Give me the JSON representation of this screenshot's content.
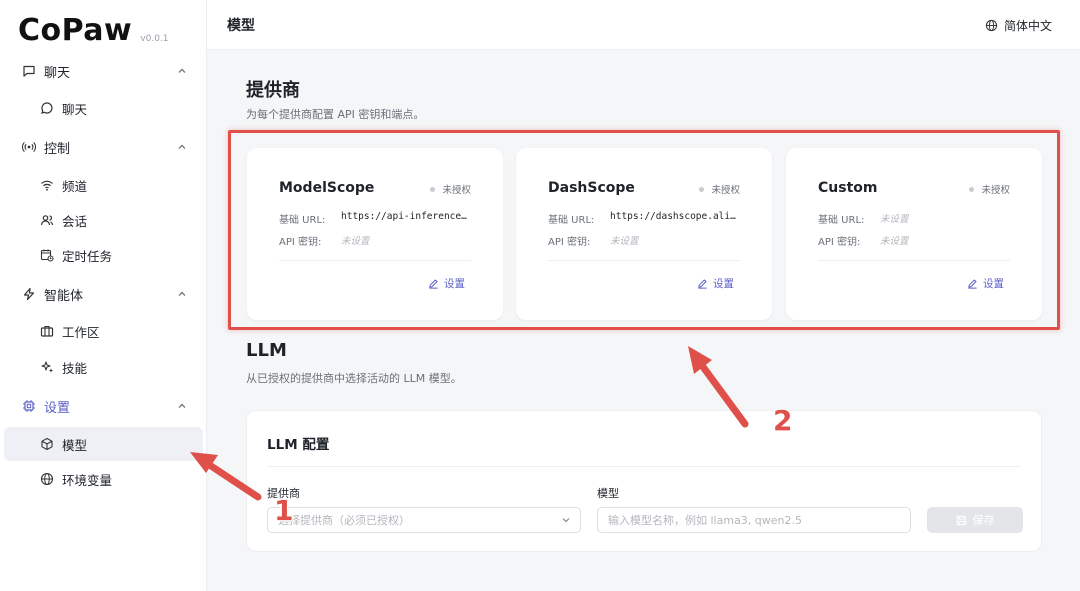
{
  "app": {
    "logo": "CoPaw",
    "version": "v0.0.1"
  },
  "header": {
    "title": "模型",
    "language": "简体中文"
  },
  "sidebar": {
    "groups": [
      {
        "label": "聊天",
        "icon": "message-square-icon",
        "items": [
          {
            "label": "聊天",
            "icon": "chat-bubble-icon"
          }
        ]
      },
      {
        "label": "控制",
        "icon": "broadcast-icon",
        "items": [
          {
            "label": "频道",
            "icon": "wifi-icon"
          },
          {
            "label": "会话",
            "icon": "users-icon"
          },
          {
            "label": "定时任务",
            "icon": "calendar-clock-icon"
          }
        ]
      },
      {
        "label": "智能体",
        "icon": "zap-icon",
        "items": [
          {
            "label": "工作区",
            "icon": "briefcase-icon"
          },
          {
            "label": "技能",
            "icon": "sparkles-icon"
          }
        ]
      },
      {
        "label": "设置",
        "icon": "cpu-icon",
        "items": [
          {
            "label": "模型",
            "icon": "cube-icon",
            "active": true
          },
          {
            "label": "环境变量",
            "icon": "globe-icon"
          }
        ]
      }
    ]
  },
  "providers": {
    "title": "提供商",
    "description": "为每个提供商配置 API 密钥和端点。",
    "cards": [
      {
        "name": "ModelScope",
        "status": "未授权",
        "url_label": "基础 URL:",
        "url": "https://api-inference…",
        "key_label": "API 密钥:",
        "key": "未设置",
        "action": "设置"
      },
      {
        "name": "DashScope",
        "status": "未授权",
        "url_label": "基础 URL:",
        "url": "https://dashscope.ali…",
        "key_label": "API 密钥:",
        "key": "未设置",
        "action": "设置"
      },
      {
        "name": "Custom",
        "status": "未授权",
        "url_label": "基础 URL:",
        "url": "未设置",
        "key_label": "API 密钥:",
        "key": "未设置",
        "action": "设置"
      }
    ]
  },
  "llm": {
    "title": "LLM",
    "description": "从已授权的提供商中选择活动的 LLM 模型。",
    "config_title": "LLM 配置",
    "provider_label": "提供商",
    "provider_placeholder": "选择提供商（必须已授权）",
    "model_label": "模型",
    "model_placeholder": "输入模型名称，例如 llama3, qwen2.5",
    "save_label": "保存"
  },
  "annotations": {
    "one": "1",
    "two": "2"
  },
  "colors": {
    "accent": "#5b5fc7",
    "annotation": "#e0504b",
    "status_dot": "#c8ccd2"
  }
}
